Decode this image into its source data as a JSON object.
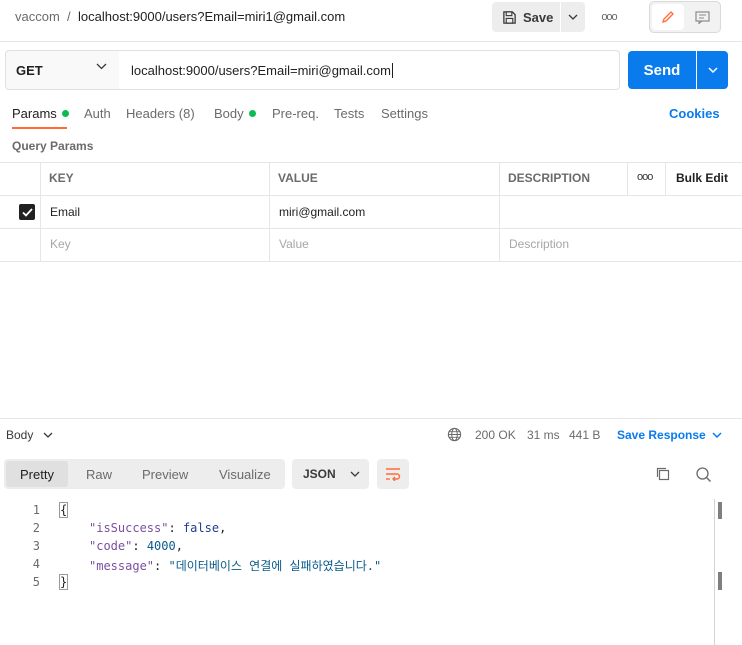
{
  "breadcrumb": {
    "workspace": "vaccom",
    "separator": "/",
    "title": "localhost:9000/users?Email=miri1@gmail.com"
  },
  "toolbar": {
    "save_label": "Save",
    "more_label": "ooo"
  },
  "request": {
    "method": "GET",
    "url": "localhost:9000/users?Email=miri@gmail.com",
    "send_label": "Send"
  },
  "tabs": {
    "params": "Params",
    "auth": "Auth",
    "headers": "Headers",
    "headers_count": "(8)",
    "body": "Body",
    "prereq": "Pre-req.",
    "tests": "Tests",
    "settings": "Settings",
    "cookies": "Cookies"
  },
  "query_params": {
    "title": "Query Params",
    "headers": {
      "key": "KEY",
      "value": "VALUE",
      "description": "DESCRIPTION",
      "more": "ooo",
      "bulk_edit": "Bulk Edit"
    },
    "rows": [
      {
        "checked": true,
        "key": "Email",
        "value": "miri@gmail.com",
        "description": ""
      }
    ],
    "placeholders": {
      "key": "Key",
      "value": "Value",
      "description": "Description"
    }
  },
  "response": {
    "section_label": "Body",
    "status": "200 OK",
    "time": "31 ms",
    "size": "441 B",
    "save_label": "Save Response",
    "formats": {
      "pretty": "Pretty",
      "raw": "Raw",
      "preview": "Preview",
      "visualize": "Visualize"
    },
    "language": "JSON",
    "code_lines": [
      "1",
      "2",
      "3",
      "4",
      "5"
    ],
    "json": {
      "open": "{",
      "close": "}",
      "k1": "\"isSuccess\"",
      "v1": "false",
      "k2": "\"code\"",
      "v2": "4000",
      "k3": "\"message\"",
      "v3": "\"데이터베이스 연결에 실패하였습니다.\"",
      "colon": ": ",
      "comma": ","
    }
  },
  "colors": {
    "accent": "#097bed",
    "tab_underline": "#ff6c37",
    "status_dot": "#0cbb52"
  }
}
